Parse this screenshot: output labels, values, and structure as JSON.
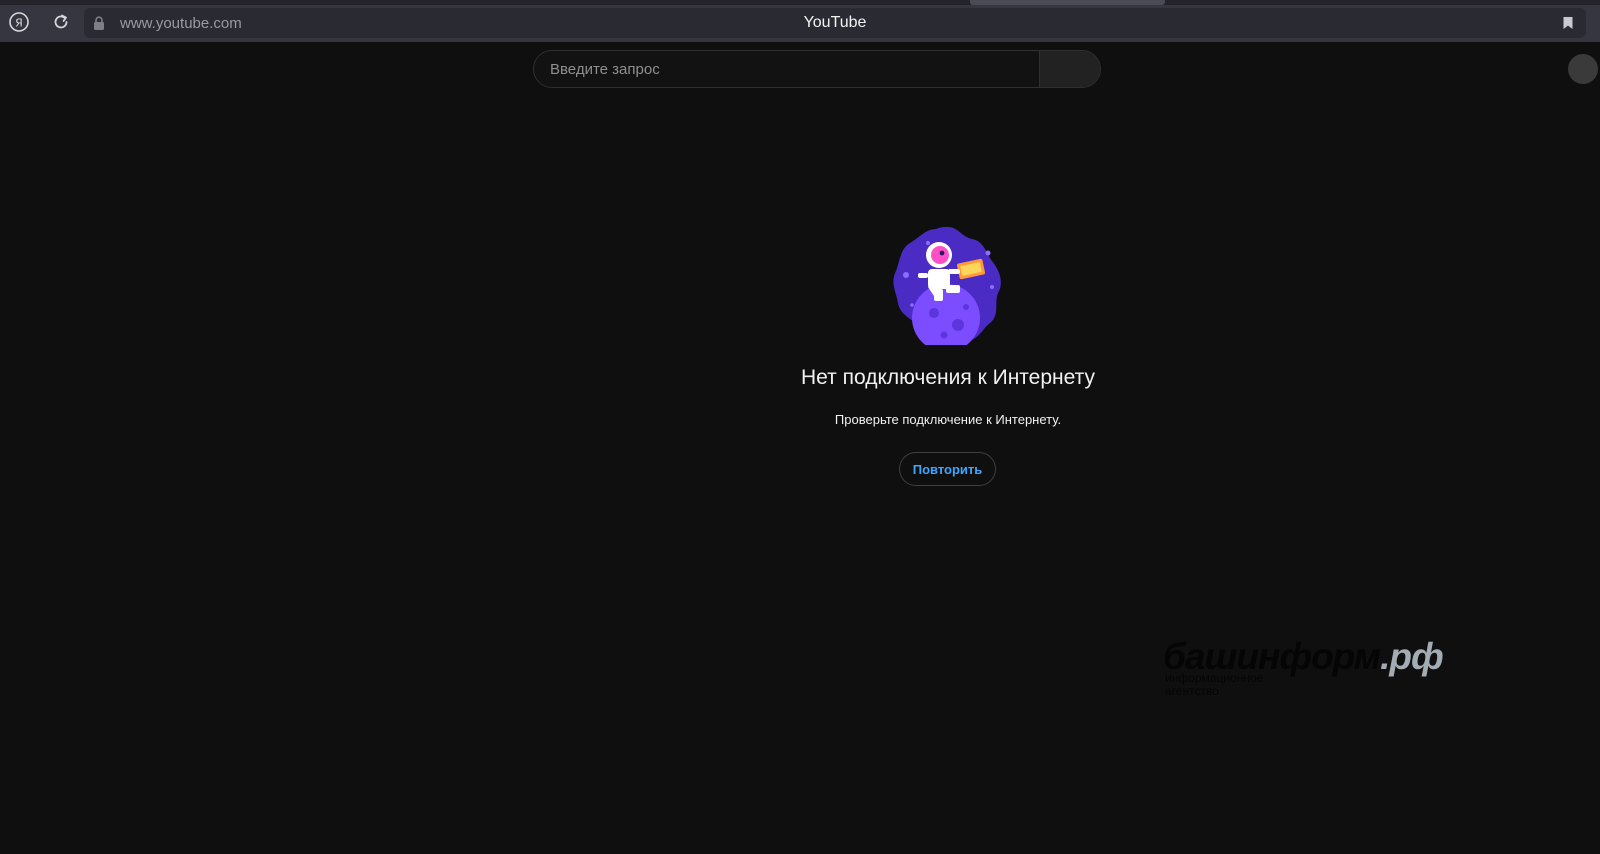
{
  "browser": {
    "url": "www.youtube.com",
    "tab_title": "YouTube",
    "icons": [
      "yandex-icon",
      "reload-icon",
      "lock-icon",
      "bookmark-icon"
    ]
  },
  "search": {
    "placeholder": "Введите запрос",
    "value": ""
  },
  "offline": {
    "title": "Нет подключения к Интернету",
    "subtitle": "Проверьте подключение к Интернету.",
    "retry_label": "Повторить"
  },
  "watermark": {
    "main_dark": "башинформ",
    "main_light": ".рф",
    "sub_line1": "информационное",
    "sub_line2": "агентство"
  },
  "colors": {
    "page_bg": "#0f0f0f",
    "browser_bar": "#35363f",
    "accent_link": "#3ea6ff",
    "illustration_purple": "#6b3ff2"
  }
}
